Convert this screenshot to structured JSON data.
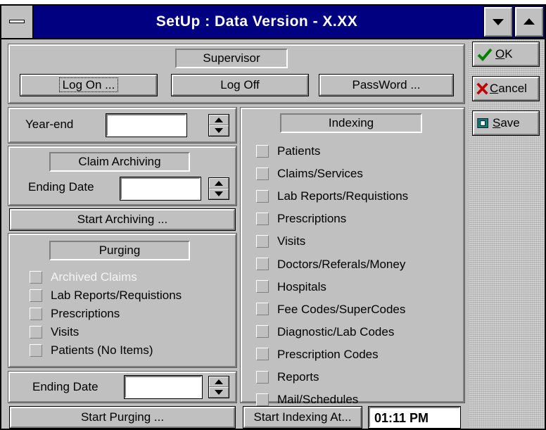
{
  "window": {
    "title": "SetUp : Data Version - X.XX"
  },
  "supervisor": {
    "label": "Supervisor",
    "log_on": "Log On ...",
    "log_off": "Log Off",
    "password": "PassWord ..."
  },
  "year_end": {
    "label": "Year-end",
    "value": ""
  },
  "claim_archiving": {
    "label": "Claim Archiving",
    "ending_date_label": "Ending Date",
    "ending_date_value": "",
    "start_button": "Start Archiving ..."
  },
  "purging": {
    "label": "Purging",
    "items": [
      {
        "label": "Archived Claims",
        "enabled": false
      },
      {
        "label": "Lab Reports/Requistions",
        "enabled": true
      },
      {
        "label": "Prescriptions",
        "enabled": true
      },
      {
        "label": "Visits",
        "enabled": true
      },
      {
        "label": "Patients (No Items)",
        "enabled": true
      }
    ],
    "ending_date_label": "Ending Date",
    "ending_date_value": "",
    "start_button": "Start Purging ..."
  },
  "indexing": {
    "label": "Indexing",
    "items": [
      {
        "label": "Patients"
      },
      {
        "label": "Claims/Services"
      },
      {
        "label": "Lab Reports/Requistions"
      },
      {
        "label": "Prescriptions"
      },
      {
        "label": "Visits"
      },
      {
        "label": "Doctors/Referals/Money"
      },
      {
        "label": "Hospitals"
      },
      {
        "label": "Fee Codes/SuperCodes"
      },
      {
        "label": "Diagnostic/Lab Codes"
      },
      {
        "label": "Prescription Codes"
      },
      {
        "label": "Reports"
      },
      {
        "label": "Mail/Schedules"
      }
    ],
    "start_button": "Start Indexing At...",
    "time_value": "01:11 PM"
  },
  "side_buttons": {
    "ok_hotkey": "O",
    "ok_rest": "K",
    "cancel_hotkey": "C",
    "cancel_rest": "ancel",
    "save_hotkey": "S",
    "save_rest": "ave"
  },
  "colors": {
    "title_bar": "#000080",
    "face": "#c0c0c0",
    "ok_check": "#008000",
    "cancel_x": "#c00000",
    "save_icon": "#008080"
  }
}
